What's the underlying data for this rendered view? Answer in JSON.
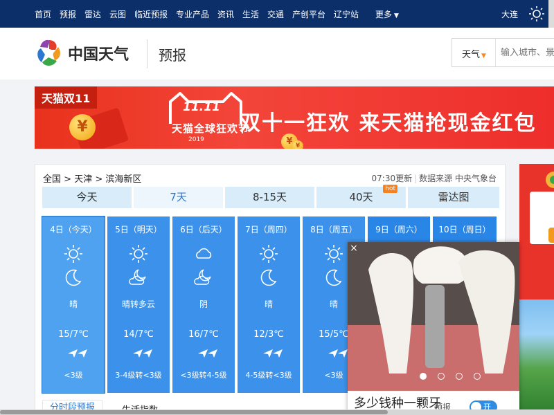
{
  "topnav": {
    "items": [
      "首页",
      "预报",
      "雷达",
      "云图",
      "临近预报",
      "专业产品",
      "资讯",
      "生活",
      "交通",
      "产创平台",
      "辽宁站",
      "更多"
    ],
    "more_caret": "▼",
    "city": "大连"
  },
  "header": {
    "brand": "中国天气",
    "section": "预报",
    "search_type": "天气",
    "search_caret": "▼",
    "search_placeholder": "输入城市、景"
  },
  "banner": {
    "tag": "天猫双11",
    "event_title": "天猫全球狂欢节",
    "event_logo": "11.11",
    "event_year": "2019",
    "slogan": "双十一狂欢 来天猫抢现金红包",
    "coin": "¥"
  },
  "weather": {
    "breadcrumb": [
      "全国",
      "天津",
      "滨海新区"
    ],
    "crumb_sep": ">",
    "updated": "07:30更新",
    "source": "数据来源 中央气象台",
    "tabs": [
      {
        "label": "今天"
      },
      {
        "label": "7天"
      },
      {
        "label": "8-15天"
      },
      {
        "label": "40天",
        "badge": "hot"
      },
      {
        "label": "雷达图"
      }
    ],
    "days": [
      {
        "name": "4日（今天）",
        "desc": "晴",
        "temp": "15/7℃",
        "wind": "<3级",
        "icons": [
          "sun-icon",
          "moon-icon"
        ]
      },
      {
        "name": "5日（明天）",
        "desc": "晴转多云",
        "temp": "14/7℃",
        "wind": "3-4级转<3级",
        "icons": [
          "sun-icon",
          "cloud-moon-icon"
        ]
      },
      {
        "name": "6日（后天）",
        "desc": "阴",
        "temp": "16/7℃",
        "wind": "<3级转4-5级",
        "icons": [
          "cloud-icon",
          "cloud-moon-icon"
        ]
      },
      {
        "name": "7日（周四）",
        "desc": "晴",
        "temp": "12/3℃",
        "wind": "4-5级转<3级",
        "icons": [
          "sun-icon",
          "moon-icon"
        ]
      },
      {
        "name": "8日（周五）",
        "desc": "晴",
        "temp": "15/5℃",
        "wind": "<3级",
        "icons": [
          "sun-icon",
          "moon-icon"
        ]
      },
      {
        "name": "9日（周六）",
        "icons": []
      },
      {
        "name": "10日（周日）",
        "icons": []
      }
    ],
    "subtabs": [
      "分时段预报",
      "生活指数"
    ]
  },
  "popup": {
    "close": "×",
    "caption": "多少钱种一颗牙",
    "toggle_prefix": "预报",
    "toggle_label": "开"
  },
  "colors": {
    "nav_bg": "#0c2f69",
    "banner_red": "#ee2e2b",
    "day_active": "#4ea2ef",
    "day_blue": "#3c92ea",
    "tab_bg": "#d8ecfa",
    "accent": "#2b78d0"
  }
}
